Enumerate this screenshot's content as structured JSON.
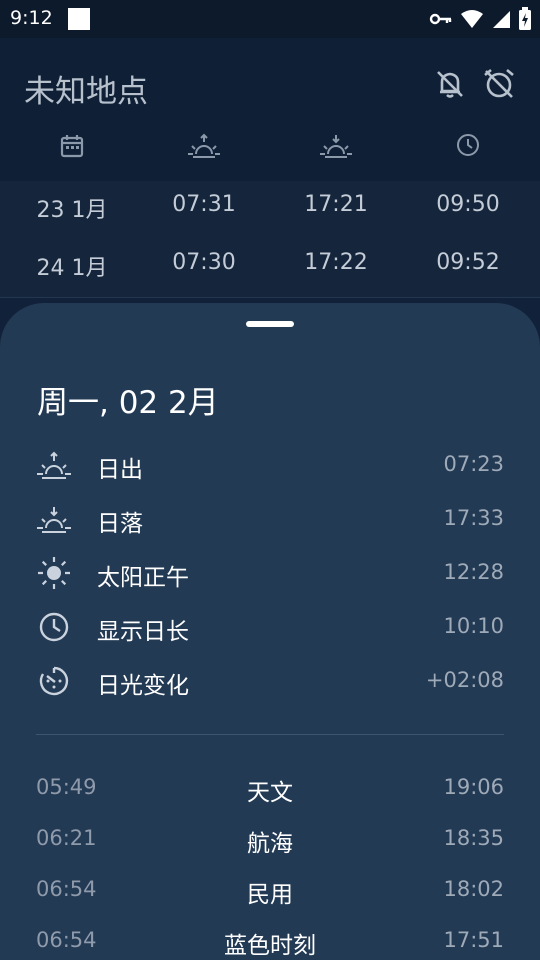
{
  "status_bar": {
    "time": "9:12"
  },
  "header": {
    "location": "未知地点",
    "title_icons": [
      "bell-off-icon",
      "alarm-off-icon"
    ],
    "column_icons": [
      "calendar-icon",
      "sunrise-icon",
      "sunset-icon",
      "clock-icon"
    ]
  },
  "table": {
    "rows": [
      {
        "date": "23 1月",
        "sunrise": "07:31",
        "sunset": "17:21",
        "day_length": "09:50"
      },
      {
        "date": "24 1月",
        "sunrise": "07:30",
        "sunset": "17:22",
        "day_length": "09:52"
      }
    ]
  },
  "sheet": {
    "date": "周一, 02 2月",
    "details": [
      {
        "icon": "sunrise-icon",
        "label": "日出",
        "value": "07:23"
      },
      {
        "icon": "sunset-icon",
        "label": "日落",
        "value": "17:33"
      },
      {
        "icon": "sun-icon",
        "label": "太阳正午",
        "value": "12:28"
      },
      {
        "icon": "clock-icon",
        "label": "显示日长",
        "value": "10:10"
      },
      {
        "icon": "timer-icon",
        "label": "日光变化",
        "value": "+02:08"
      }
    ],
    "twilight": [
      {
        "start": "05:49",
        "label": "天文",
        "end": "19:06"
      },
      {
        "start": "06:21",
        "label": "航海",
        "end": "18:35"
      },
      {
        "start": "06:54",
        "label": "民用",
        "end": "18:02"
      },
      {
        "start": "06:54",
        "label": "蓝色时刻",
        "end": "17:51"
      }
    ]
  },
  "colors": {
    "background": "#11213a",
    "sheet": "#233a54",
    "text_primary": "#ffffff",
    "text_secondary": "#9faab8"
  }
}
